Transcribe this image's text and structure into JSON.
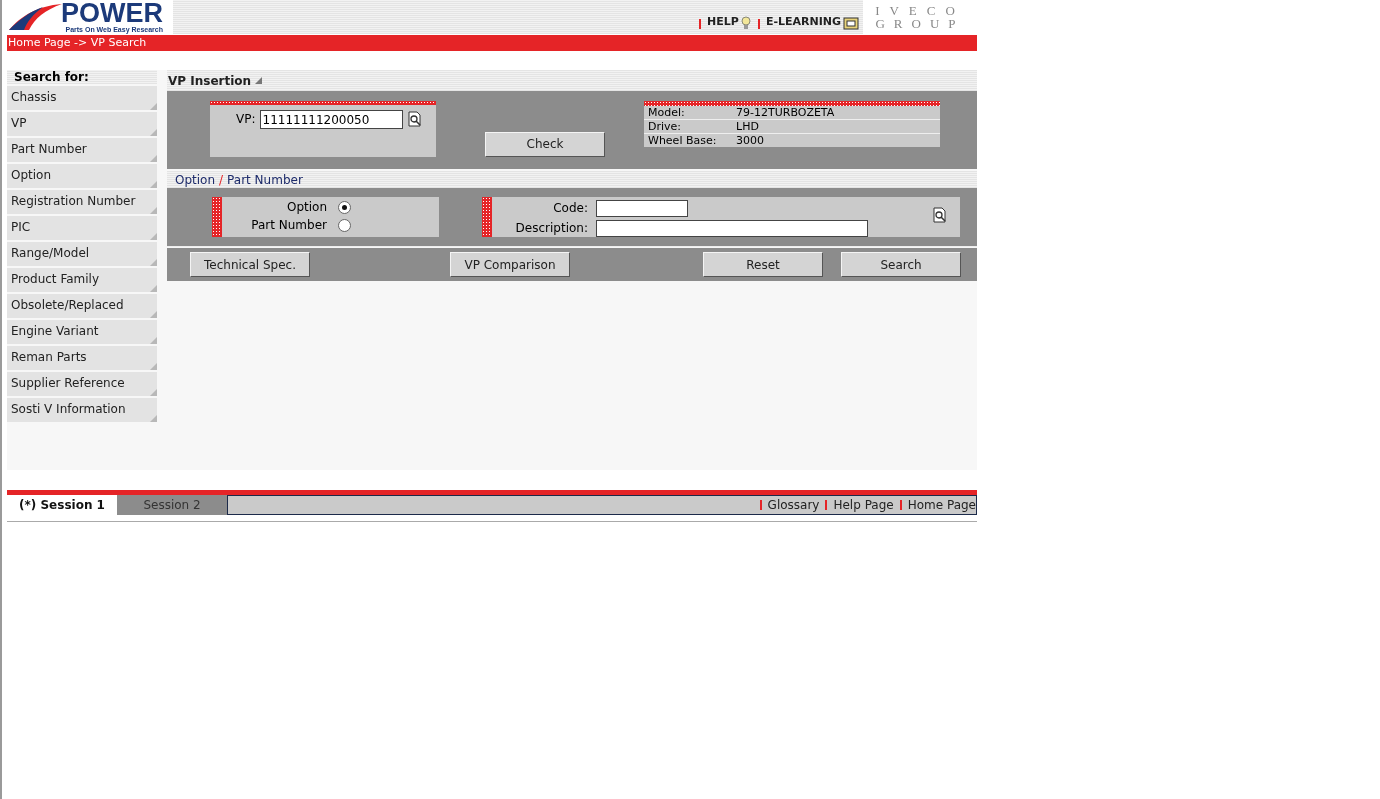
{
  "header": {
    "logo_title": "POWER",
    "logo_subtitle": "Parts On Web Easy Research",
    "links": [
      {
        "label": "HELP",
        "kind": "help"
      },
      {
        "label": "E-LEARNING",
        "kind": "learning"
      }
    ],
    "group_logo": {
      "line1": "IVECO",
      "line2": "GROUP"
    }
  },
  "breadcrumb": "Home Page -> VP Search",
  "sidebar": {
    "title": "Search for:",
    "items": [
      {
        "label": "Chassis"
      },
      {
        "label": "VP"
      },
      {
        "label": "Part Number"
      },
      {
        "label": "Option"
      },
      {
        "label": "Registration Number"
      },
      {
        "label": "PIC"
      },
      {
        "label": "Range/Model"
      },
      {
        "label": "Product Family"
      },
      {
        "label": "Obsolete/Replaced"
      },
      {
        "label": "Engine Variant"
      },
      {
        "label": "Reman Parts"
      },
      {
        "label": "Supplier Reference"
      },
      {
        "label": "Sosti V Information"
      }
    ]
  },
  "vp_section": {
    "title": "VP Insertion",
    "vp_label": "VP:",
    "vp_value": "11111111200050",
    "check_button": "Check",
    "info": [
      {
        "label": "Model:",
        "value": "79-12TURBOZETA"
      },
      {
        "label": "Drive:",
        "value": "LHD"
      },
      {
        "label": "Wheel Base:",
        "value": "3000"
      }
    ]
  },
  "option_section": {
    "title_parts": [
      "Option",
      "/",
      "Part Number"
    ],
    "radios": [
      {
        "label": "Option",
        "selected": true
      },
      {
        "label": "Part Number",
        "selected": false
      }
    ],
    "fields": [
      {
        "label": "Code:",
        "kind": "short"
      },
      {
        "label": "Description:",
        "kind": "long"
      }
    ]
  },
  "buttons": [
    "Technical Spec.",
    "VP Comparison",
    "Reset",
    "Search"
  ],
  "footer": {
    "tabs": [
      {
        "label": "(*) Session 1",
        "selected": true
      },
      {
        "label": "Session 2",
        "selected": false
      }
    ],
    "links": [
      "Glossary",
      "Help Page",
      "Home Page"
    ]
  }
}
